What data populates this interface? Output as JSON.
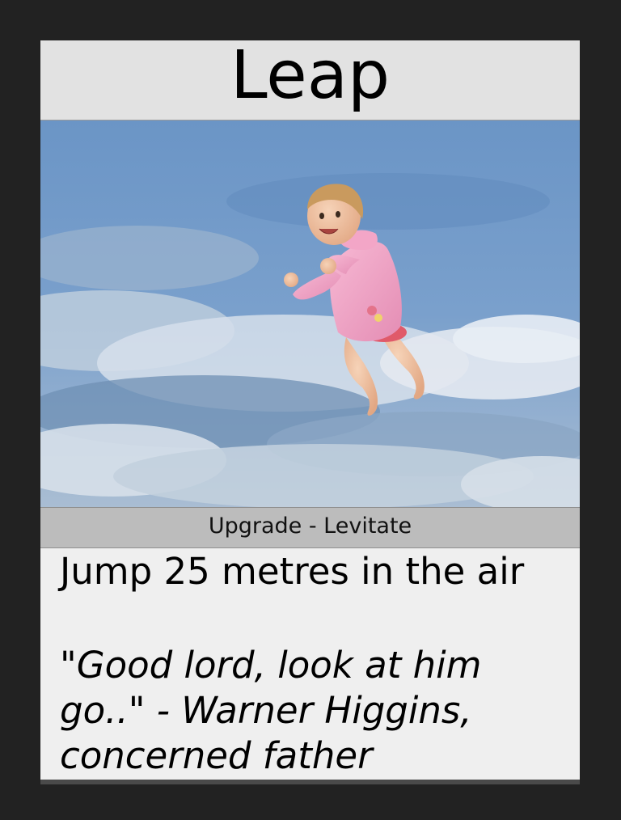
{
  "card": {
    "name": "Leap",
    "type_line": "Upgrade - Levitate",
    "rules_text": "Jump 25 metres in the air",
    "flavor_text": "\"Good lord, look at him go..\" - Warner Higgins, concerned father",
    "art": {
      "subject": "flying baby in pink jacket against cloudy blue sky",
      "sky_color": "#6f98c7",
      "cloud_color": "#e6ebf0",
      "jacket_color": "#f2a8c8"
    }
  },
  "colors": {
    "background": "#222222",
    "title_bar": "#e2e2e2",
    "type_bar": "#bcbcbc",
    "text_box": "#efefef"
  }
}
